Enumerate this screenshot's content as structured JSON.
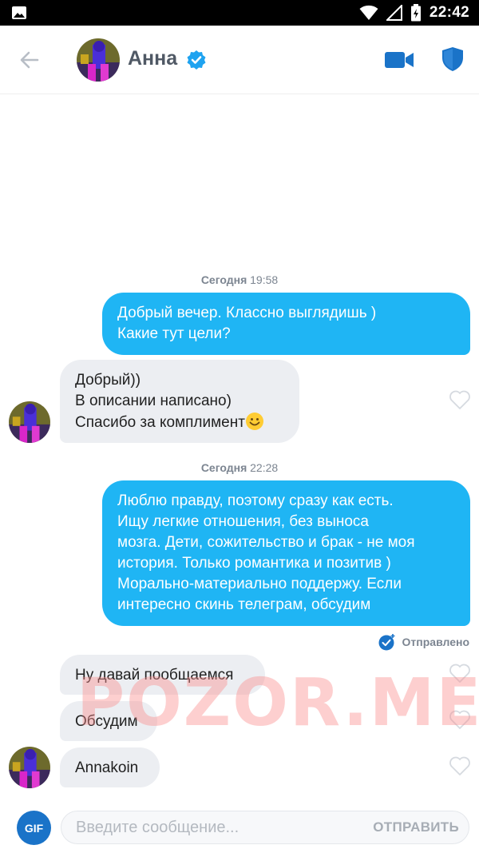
{
  "status_bar": {
    "time": "22:42",
    "icons": [
      "image-icon",
      "wifi-icon",
      "signal-icon",
      "battery-icon"
    ]
  },
  "header": {
    "contact_name": "Анна",
    "verified": true,
    "icons": [
      "back-arrow-icon",
      "verified-badge-icon",
      "video-call-icon",
      "shield-icon"
    ],
    "accent_color": "#1a73c8"
  },
  "messages": {
    "ts1": {
      "prefix": "Сегодня",
      "time": "19:58"
    },
    "out1": {
      "lines": [
        "Добрый вечер. Классно выглядишь )",
        "Какие тут цели?"
      ]
    },
    "in1": {
      "lines": [
        "Добрый))",
        "В описании написано)",
        "Спасибо за комплимент"
      ],
      "emoji": "smiling-face-emoji"
    },
    "ts2": {
      "prefix": "Сегодня",
      "time": "22:28"
    },
    "out2": {
      "lines": [
        "Люблю правду, поэтому сразу как есть.",
        "Ищу легкие отношения, без выноса",
        "мозга. Дети, сожительство и брак - не моя",
        "история. Только романтика и позитив )",
        "Морально-материально поддержу. Если",
        "интересно скинь телеграм, обсудим"
      ]
    },
    "status": "Отправлено",
    "in2": {
      "text": "Ну давай пообщаемся"
    },
    "in3": {
      "text": "Обсудим"
    },
    "in4": {
      "text": "Annakoin"
    }
  },
  "watermark": "POZOR.ME",
  "composer": {
    "gif_label": "GIF",
    "placeholder": "Введите сообщение...",
    "send_label": "ОТПРАВИТЬ"
  },
  "colors": {
    "outgoing_bubble": "#1fb5f4",
    "incoming_bubble": "#eceef2",
    "muted_text": "#7c8591"
  }
}
